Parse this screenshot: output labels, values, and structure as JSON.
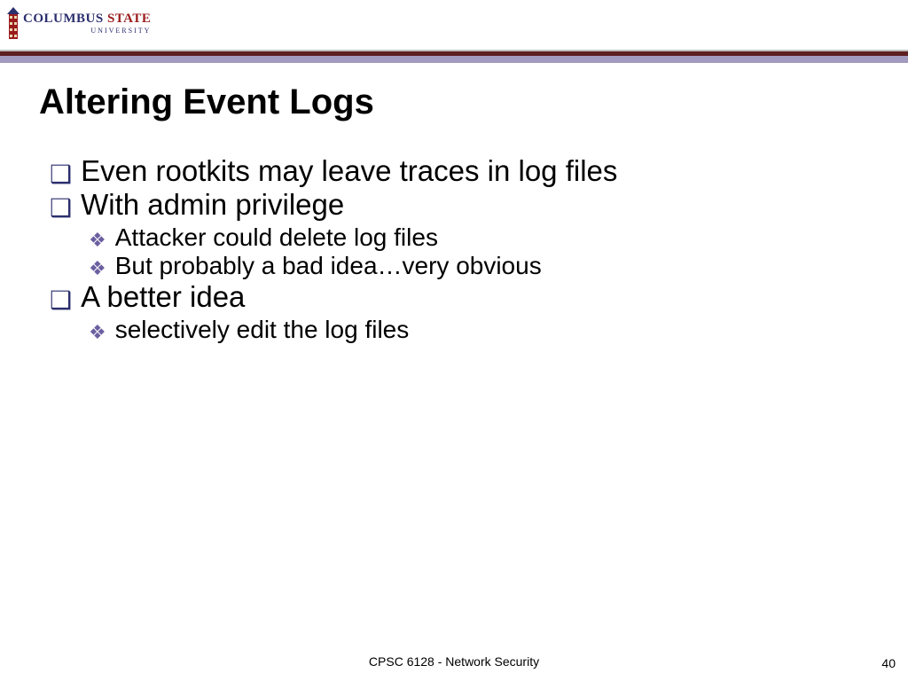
{
  "logo": {
    "line1_a": "COLUMBUS ",
    "line1_b": "STATE",
    "line2": "UNIVERSITY"
  },
  "title": "Altering Event Logs",
  "body": {
    "l1a": "Even rootkits may leave traces in log files",
    "l1b": "With admin privilege",
    "l2a": "Attacker could delete log files",
    "l2b": "But probably a bad idea…very obvious",
    "l1c": "A better idea",
    "l2c": "selectively edit the log files"
  },
  "footer": {
    "course": "CPSC 6128 - Network Security",
    "page": "40"
  },
  "bullets": {
    "square": "❑",
    "diamond": "❖"
  }
}
